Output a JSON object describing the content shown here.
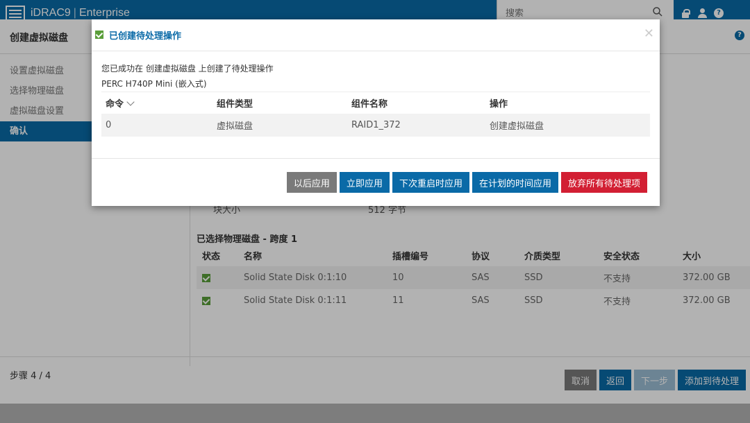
{
  "header": {
    "brand": "iDRAC9",
    "edition": "Enterprise",
    "search_placeholder": "搜索"
  },
  "wizard": {
    "title": "创建虚拟磁盘",
    "steps": [
      {
        "label": "设置虚拟磁盘"
      },
      {
        "label": "选择物理磁盘"
      },
      {
        "label": "虚拟磁盘设置"
      },
      {
        "label": "确认"
      }
    ],
    "block_size_label": "块大小",
    "block_size_value": "512 字节",
    "selected_title": "已选择物理磁盘 - 跨度 1",
    "disk_columns": [
      "状态",
      "名称",
      "插槽编号",
      "协议",
      "介质类型",
      "安全状态",
      "大小"
    ],
    "disks": [
      {
        "name": "Solid State Disk 0:1:10",
        "slot": "10",
        "protocol": "SAS",
        "media": "SSD",
        "security": "不支持",
        "size": "372.00 GB"
      },
      {
        "name": "Solid State Disk 0:1:11",
        "slot": "11",
        "protocol": "SAS",
        "media": "SSD",
        "security": "不支持",
        "size": "372.00 GB"
      }
    ],
    "step_label": "步骤 4 / 4",
    "buttons": {
      "cancel": "取消",
      "back": "返回",
      "next": "下一步",
      "add": "添加到待处理"
    }
  },
  "modal": {
    "title": "已创建待处理操作",
    "message": "您已成功在 创建虚拟磁盘 上创建了待处理操作",
    "controller": "PERC H740P Mini (嵌入式)",
    "columns": [
      "命令",
      "组件类型",
      "组件名称",
      "操作"
    ],
    "rows": [
      {
        "command": "0",
        "type": "虚拟磁盘",
        "name": "RAID1_372",
        "operation": "创建虚拟磁盘"
      }
    ],
    "buttons": {
      "later": "以后应用",
      "now": "立即应用",
      "next_reboot": "下次重启时应用",
      "scheduled": "在计划的时间应用",
      "discard": "放弃所有待处理项"
    }
  }
}
